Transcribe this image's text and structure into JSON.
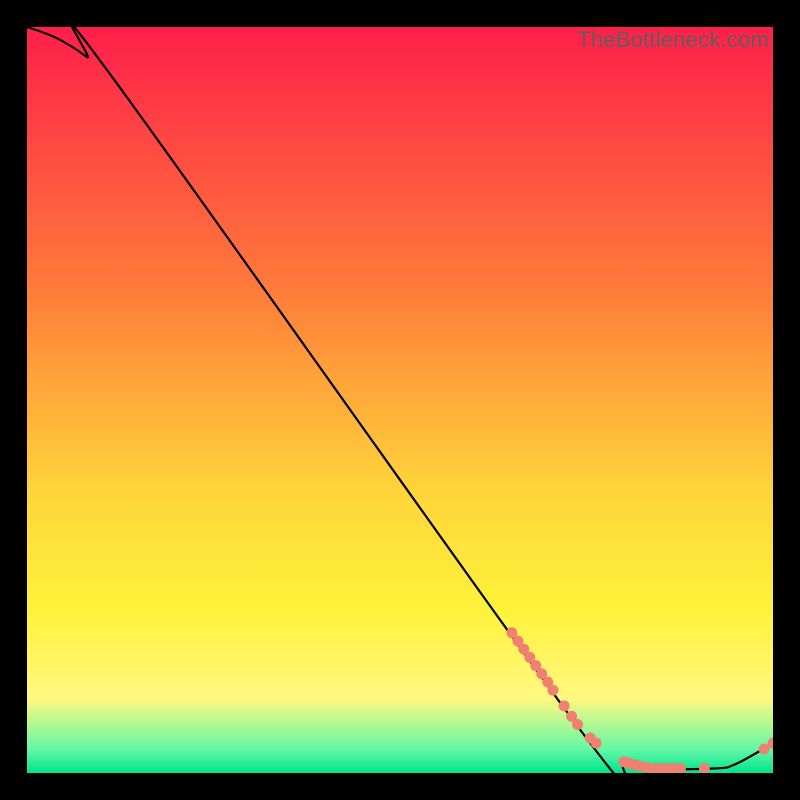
{
  "watermark": {
    "text": "TheBottleneck.com"
  },
  "colors": {
    "gradient_top": "#ff1f4a",
    "gradient_mid1": "#ff7b3a",
    "gradient_mid2": "#ffd43a",
    "gradient_mid3": "#fff23a",
    "gradient_bottom1": "#fff880",
    "gradient_bottom2": "#5ff7a6",
    "gradient_bottom3": "#00e58a",
    "line": "#000000",
    "marker": "#f08072"
  },
  "chart_data": {
    "type": "line",
    "title": "",
    "xlabel": "",
    "ylabel": "",
    "xlim": [
      0,
      100
    ],
    "ylim": [
      0,
      100
    ],
    "curve": [
      {
        "x": 0,
        "y": 100
      },
      {
        "x": 4,
        "y": 98.5
      },
      {
        "x": 8,
        "y": 96
      },
      {
        "x": 12,
        "y": 92.5
      },
      {
        "x": 74,
        "y": 6
      },
      {
        "x": 80,
        "y": 1.5
      },
      {
        "x": 84,
        "y": 0.6
      },
      {
        "x": 92,
        "y": 0.6
      },
      {
        "x": 95,
        "y": 1.2
      },
      {
        "x": 100,
        "y": 4
      }
    ],
    "marker_clusters": [
      {
        "label": "descent-cluster",
        "points": [
          {
            "x": 65.0,
            "y": 18.8
          },
          {
            "x": 65.8,
            "y": 17.7
          },
          {
            "x": 66.6,
            "y": 16.6
          },
          {
            "x": 67.4,
            "y": 15.5
          },
          {
            "x": 68.2,
            "y": 14.4
          },
          {
            "x": 69.0,
            "y": 13.3
          },
          {
            "x": 69.8,
            "y": 12.2
          },
          {
            "x": 70.5,
            "y": 11.1
          },
          {
            "x": 72.0,
            "y": 9.0
          },
          {
            "x": 73.0,
            "y": 7.6
          },
          {
            "x": 73.8,
            "y": 6.5
          },
          {
            "x": 75.5,
            "y": 4.7
          },
          {
            "x": 76.3,
            "y": 4.0
          }
        ]
      },
      {
        "label": "valley-cluster",
        "points": [
          {
            "x": 80.0,
            "y": 1.5
          },
          {
            "x": 80.7,
            "y": 1.3
          },
          {
            "x": 81.4,
            "y": 1.1
          },
          {
            "x": 82.3,
            "y": 0.9
          },
          {
            "x": 83.3,
            "y": 0.7
          },
          {
            "x": 84.2,
            "y": 0.6
          },
          {
            "x": 85.0,
            "y": 0.6
          },
          {
            "x": 85.8,
            "y": 0.6
          },
          {
            "x": 86.7,
            "y": 0.6
          },
          {
            "x": 87.6,
            "y": 0.6
          },
          {
            "x": 90.8,
            "y": 0.6
          }
        ]
      },
      {
        "label": "tail-cluster",
        "points": [
          {
            "x": 98.8,
            "y": 3.2
          },
          {
            "x": 100.0,
            "y": 4.0
          }
        ]
      }
    ]
  }
}
